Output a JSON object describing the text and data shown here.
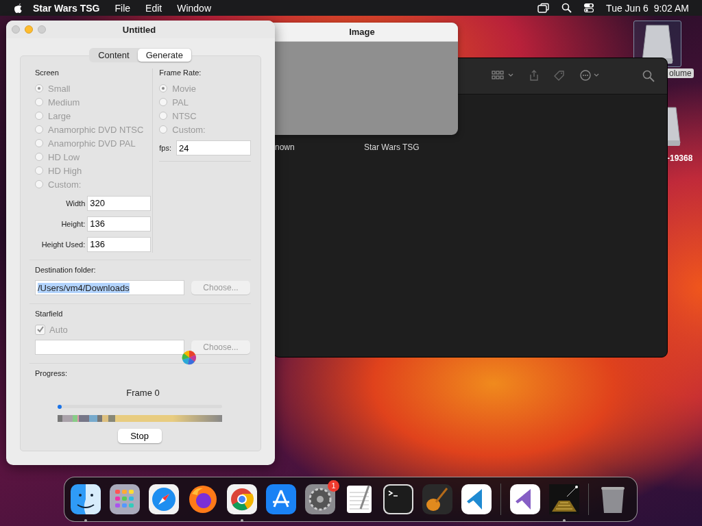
{
  "menu_bar": {
    "app_name": "Star Wars TSG",
    "menus": [
      "File",
      "Edit",
      "Window"
    ],
    "clock": "Tue Jun 6  9:02 AM"
  },
  "desktop_icons": [
    {
      "label": "olume",
      "selected": true
    },
    {
      "label": "-19368",
      "selected": false
    }
  ],
  "finder_window": {
    "items": [
      "nown",
      "Star Wars TSG"
    ]
  },
  "image_window": {
    "title": "Image"
  },
  "main_window": {
    "title": "Untitled",
    "tabs": [
      {
        "label": "Content",
        "selected": false
      },
      {
        "label": "Generate",
        "selected": true
      }
    ],
    "screen": {
      "label": "Screen",
      "options": [
        {
          "label": "Small",
          "selected": true,
          "disabled": true
        },
        {
          "label": "Medium",
          "selected": false,
          "disabled": true
        },
        {
          "label": "Large",
          "selected": false,
          "disabled": true
        },
        {
          "label": "Anamorphic DVD NTSC",
          "selected": false,
          "disabled": true
        },
        {
          "label": "Anamorphic DVD PAL",
          "selected": false,
          "disabled": true
        },
        {
          "label": "HD Low",
          "selected": false,
          "disabled": true
        },
        {
          "label": "HD High",
          "selected": false,
          "disabled": true
        },
        {
          "label": "Custom:",
          "selected": false,
          "disabled": true
        }
      ],
      "fields": [
        {
          "label": "Width",
          "value": "320"
        },
        {
          "label": "Height:",
          "value": "136"
        },
        {
          "label": "Height Used:",
          "value": "136"
        }
      ]
    },
    "frame_rate": {
      "label": "Frame Rate:",
      "options": [
        {
          "label": "Movie",
          "selected": true,
          "disabled": true
        },
        {
          "label": "PAL",
          "selected": false,
          "disabled": true
        },
        {
          "label": "NTSC",
          "selected": false,
          "disabled": true
        },
        {
          "label": "Custom:",
          "selected": false,
          "disabled": true
        }
      ],
      "fps_label": "fps:",
      "fps_value": "24"
    },
    "destination": {
      "label": "Destination folder:",
      "value": "/Users/vm4/Downloads",
      "button": "Choose...",
      "button_disabled": true
    },
    "starfield": {
      "label": "Starfield",
      "auto_label": "Auto",
      "auto_checked": true,
      "auto_disabled": true,
      "button": "Choose...",
      "button_disabled": true
    },
    "progress": {
      "label": "Progress:",
      "frame": "Frame 0",
      "level": 0,
      "button": "Stop"
    }
  },
  "dock": [
    {
      "kind": "app",
      "running": true
    },
    {
      "kind": "app",
      "running": false
    },
    {
      "kind": "app",
      "running": false
    },
    {
      "kind": "app",
      "running": false
    },
    {
      "kind": "app",
      "running": true
    },
    {
      "kind": "app",
      "running": false
    },
    {
      "kind": "app",
      "running": false,
      "badge": "1"
    },
    {
      "kind": "app",
      "running": false
    },
    {
      "kind": "app",
      "running": false
    },
    {
      "kind": "app",
      "running": false
    },
    {
      "kind": "app",
      "running": false
    },
    {
      "kind": "separator"
    },
    {
      "kind": "app",
      "running": false
    },
    {
      "kind": "app",
      "running": true
    },
    {
      "kind": "separator"
    },
    {
      "kind": "app",
      "running": false
    }
  ]
}
